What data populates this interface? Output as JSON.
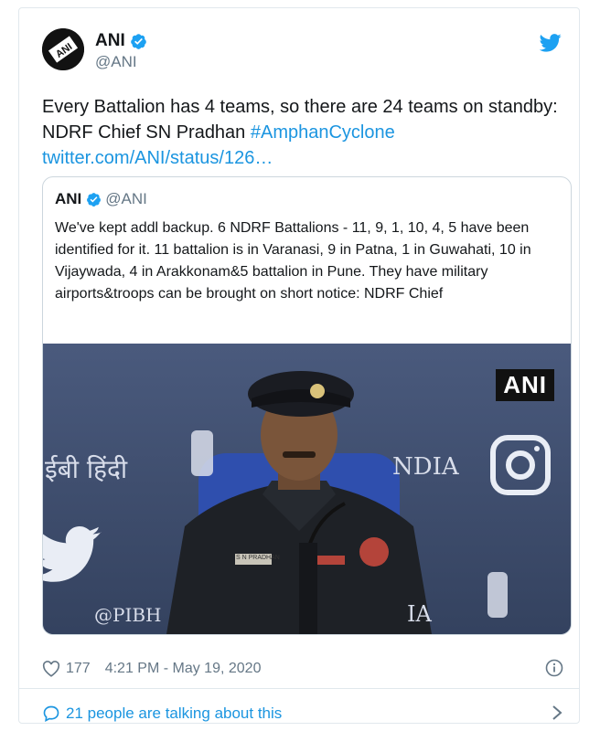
{
  "author": {
    "name": "ANI",
    "handle": "@ANI",
    "avatar_text": "ANI"
  },
  "tweet": {
    "line1": "Every Battalion has 4 teams, so there are 24 teams on standby:",
    "line2_prefix": "NDRF Chief SN Pradhan ",
    "hashtag": "#AmphanCyclone",
    "link": "twitter.com/ANI/status/126…"
  },
  "quoted": {
    "name": "ANI",
    "handle": "@ANI",
    "text": "We've kept addl backup. 6 NDRF Battalions - 11, 9, 1, 10, 4, 5 have been identified for it. 11 battalion is in Varanasi, 9 in Patna, 1 in Guwahati, 10 in Vijaywada, 4 in Arakkonam&5 battalion in Pune. They have military airports&troops can be brought on short notice: NDRF Chief",
    "media": {
      "watermark": "ANI",
      "bg_hindi": "ईबी हिंदी",
      "bg_india": "NDIA",
      "bg_pib": "@PIBH",
      "bg_ia": "IA",
      "name_tag": "S N PRADHAN"
    }
  },
  "footer": {
    "likes": "177",
    "timestamp": "4:21 PM - May 19, 2020",
    "talking": "21 people are talking about this"
  },
  "colors": {
    "link_blue": "#1b95e0",
    "text": "#14171a",
    "muted": "#657786",
    "border": "#e1e8ed",
    "media_bg": "#3c4a69"
  },
  "icons": [
    "twitter-bird-icon",
    "verified-badge-icon",
    "heart-icon",
    "info-icon",
    "speech-bubble-icon",
    "chevron-right-icon"
  ]
}
